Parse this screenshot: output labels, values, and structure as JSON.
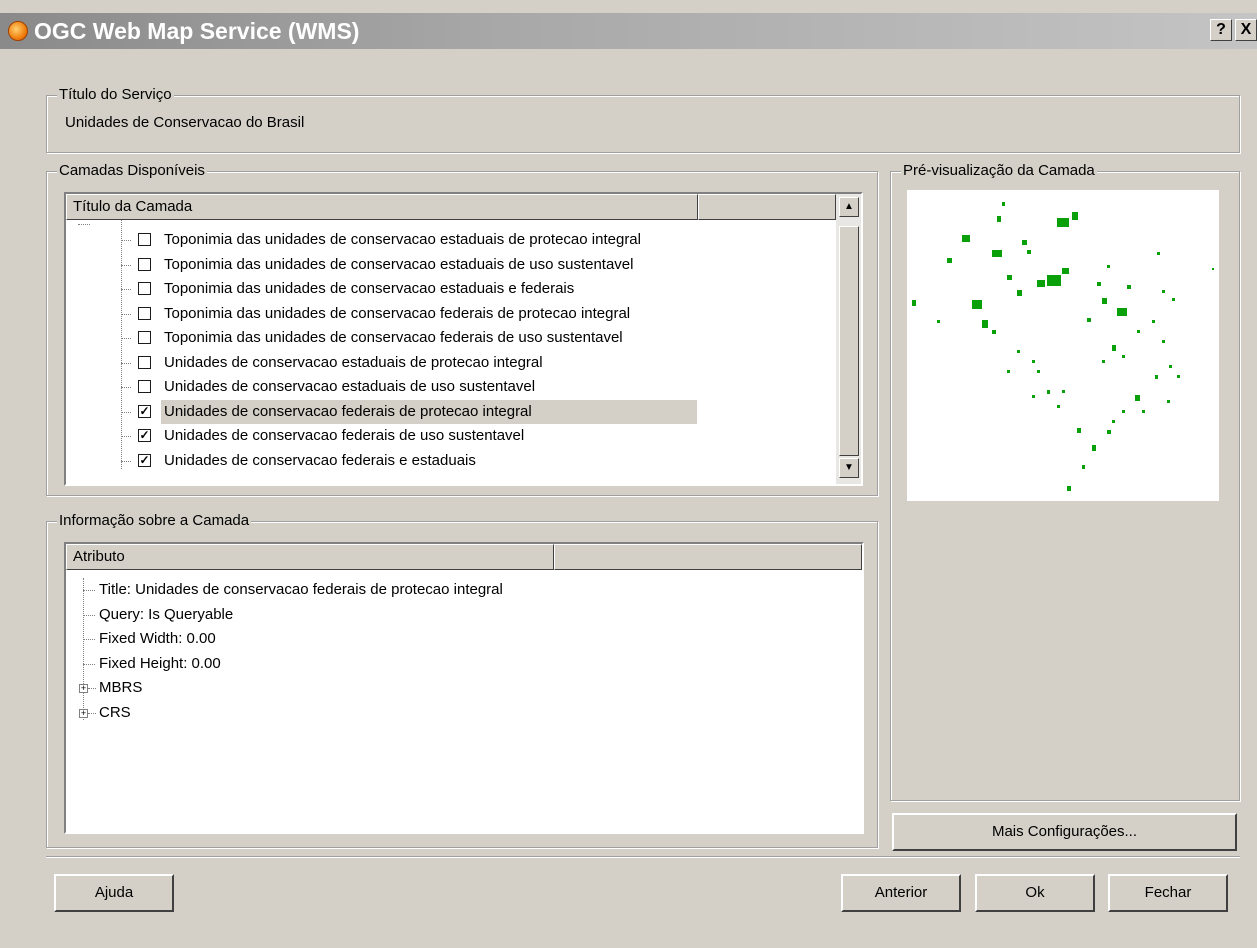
{
  "window": {
    "title": "OGC Web Map Service (WMS)",
    "help_glyph": "?",
    "close_glyph": "X"
  },
  "service_title": {
    "legend": "Título do Serviço",
    "value": "Unidades de Conservacao do Brasil"
  },
  "layers": {
    "legend": "Camadas Disponíveis",
    "column_header": "Título da Camada",
    "items": [
      {
        "label": "Toponimia das unidades de conservacao estaduais de protecao integral",
        "checked": false
      },
      {
        "label": "Toponimia das unidades de conservacao estaduais de uso sustentavel",
        "checked": false
      },
      {
        "label": "Toponimia das unidades de conservacao estaduais e federais",
        "checked": false
      },
      {
        "label": "Toponimia das unidades de conservacao federais de protecao integral",
        "checked": false
      },
      {
        "label": "Toponimia das unidades de conservacao federais de uso sustentavel",
        "checked": false
      },
      {
        "label": "Unidades de conservacao estaduais de protecao integral",
        "checked": false
      },
      {
        "label": "Unidades de conservacao estaduais de uso sustentavel",
        "checked": false
      },
      {
        "label": "Unidades de conservacao federais de protecao integral",
        "checked": true,
        "selected": true
      },
      {
        "label": "Unidades de conservacao federais de uso sustentavel",
        "checked": true
      },
      {
        "label": "Unidades de conservacao federais e estaduais",
        "checked": true
      }
    ],
    "check_glyph": "✓"
  },
  "preview": {
    "legend": "Pré-visualização da Camada",
    "feature_color": "#0aa00a"
  },
  "info": {
    "legend": "Informação sobre a Camada",
    "column_header": "Atributo",
    "items": [
      {
        "label": "Title: Unidades de conservacao federais de protecao integral",
        "expandable": false
      },
      {
        "label": "Query: Is Queryable",
        "expandable": false
      },
      {
        "label": "Fixed Width: 0.00",
        "expandable": false
      },
      {
        "label": "Fixed Height: 0.00",
        "expandable": false
      },
      {
        "label": "MBRS",
        "expandable": true
      },
      {
        "label": "CRS",
        "expandable": true
      }
    ]
  },
  "buttons": {
    "more_settings": "Mais Configurações...",
    "help": "Ajuda",
    "back": "Anterior",
    "ok": "Ok",
    "close": "Fechar"
  }
}
